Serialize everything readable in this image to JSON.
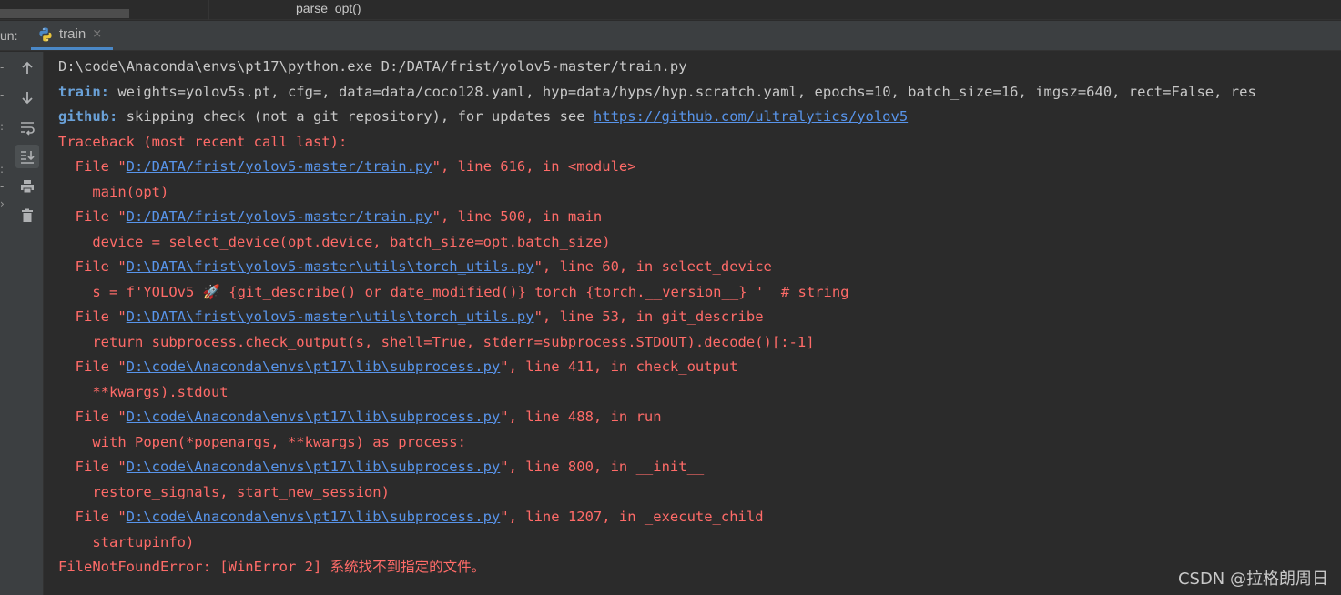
{
  "editor": {
    "code_line": "parse_opt()"
  },
  "run_panel": {
    "run_label": "un:",
    "tab_label": "train",
    "tab_close": "×"
  },
  "toolbar": {
    "buttons": [
      {
        "icon": "arrow-up-icon",
        "active": false
      },
      {
        "icon": "arrow-down-icon",
        "active": false
      },
      {
        "icon": "soft-wrap-icon",
        "active": false
      },
      {
        "icon": "scroll-to-end-icon",
        "active": true
      },
      {
        "icon": "print-icon",
        "active": false
      },
      {
        "icon": "trash-icon",
        "active": false
      }
    ]
  },
  "console": {
    "lines": [
      {
        "parts": [
          {
            "t": "D:\\code\\Anaconda\\envs\\pt17\\python.exe D:/DATA/frist/yolov5-master/train.py",
            "c": "normal"
          }
        ]
      },
      {
        "parts": [
          {
            "t": "train: ",
            "c": "key"
          },
          {
            "t": "weights=yolov5s.pt, cfg=, data=data/coco128.yaml, hyp=data/hyps/hyp.scratch.yaml, epochs=10, batch_size=16, imgsz=640, rect=False, res",
            "c": "normal"
          }
        ]
      },
      {
        "parts": [
          {
            "t": "github: ",
            "c": "key"
          },
          {
            "t": "skipping check (not a git repository), for updates see ",
            "c": "normal"
          },
          {
            "t": "https://github.com/ultralytics/yolov5",
            "c": "link"
          }
        ]
      },
      {
        "parts": [
          {
            "t": "Traceback (most recent call last):",
            "c": "err"
          }
        ]
      },
      {
        "parts": [
          {
            "t": "  File \"",
            "c": "err"
          },
          {
            "t": "D:/DATA/frist/yolov5-master/train.py",
            "c": "link"
          },
          {
            "t": "\", line 616, in <module>",
            "c": "err"
          }
        ]
      },
      {
        "parts": [
          {
            "t": "    main(opt)",
            "c": "err"
          }
        ]
      },
      {
        "parts": [
          {
            "t": "  File \"",
            "c": "err"
          },
          {
            "t": "D:/DATA/frist/yolov5-master/train.py",
            "c": "link"
          },
          {
            "t": "\", line 500, in main",
            "c": "err"
          }
        ]
      },
      {
        "parts": [
          {
            "t": "    device = select_device(opt.device, batch_size=opt.batch_size)",
            "c": "err"
          }
        ]
      },
      {
        "parts": [
          {
            "t": "  File \"",
            "c": "err"
          },
          {
            "t": "D:\\DATA\\frist\\yolov5-master\\utils\\torch_utils.py",
            "c": "link"
          },
          {
            "t": "\", line 60, in select_device",
            "c": "err"
          }
        ]
      },
      {
        "parts": [
          {
            "t": "    s = f'YOLOv5 🚀 {git_describe() or date_modified()} torch {torch.__version__} '  # string",
            "c": "err"
          }
        ]
      },
      {
        "parts": [
          {
            "t": "  File \"",
            "c": "err"
          },
          {
            "t": "D:\\DATA\\frist\\yolov5-master\\utils\\torch_utils.py",
            "c": "link"
          },
          {
            "t": "\", line 53, in git_describe",
            "c": "err"
          }
        ]
      },
      {
        "parts": [
          {
            "t": "    return subprocess.check_output(s, shell=True, stderr=subprocess.STDOUT).decode()[:-1]",
            "c": "err"
          }
        ]
      },
      {
        "parts": [
          {
            "t": "  File \"",
            "c": "err"
          },
          {
            "t": "D:\\code\\Anaconda\\envs\\pt17\\lib\\subprocess.py",
            "c": "link"
          },
          {
            "t": "\", line 411, in check_output",
            "c": "err"
          }
        ]
      },
      {
        "parts": [
          {
            "t": "    **kwargs).stdout",
            "c": "err"
          }
        ]
      },
      {
        "parts": [
          {
            "t": "  File \"",
            "c": "err"
          },
          {
            "t": "D:\\code\\Anaconda\\envs\\pt17\\lib\\subprocess.py",
            "c": "link"
          },
          {
            "t": "\", line 488, in run",
            "c": "err"
          }
        ]
      },
      {
        "parts": [
          {
            "t": "    with Popen(*popenargs, **kwargs) as process:",
            "c": "err"
          }
        ]
      },
      {
        "parts": [
          {
            "t": "  File \"",
            "c": "err"
          },
          {
            "t": "D:\\code\\Anaconda\\envs\\pt17\\lib\\subprocess.py",
            "c": "link"
          },
          {
            "t": "\", line 800, in __init__",
            "c": "err"
          }
        ]
      },
      {
        "parts": [
          {
            "t": "    restore_signals, start_new_session)",
            "c": "err"
          }
        ]
      },
      {
        "parts": [
          {
            "t": "  File \"",
            "c": "err"
          },
          {
            "t": "D:\\code\\Anaconda\\envs\\pt17\\lib\\subprocess.py",
            "c": "link"
          },
          {
            "t": "\", line 1207, in _execute_child",
            "c": "err"
          }
        ]
      },
      {
        "parts": [
          {
            "t": "    startupinfo)",
            "c": "err"
          }
        ]
      },
      {
        "parts": [
          {
            "t": "FileNotFoundError: [WinError 2] 系统找不到指定的文件。",
            "c": "err"
          }
        ]
      }
    ]
  },
  "watermark": "CSDN @拉格朗周日",
  "colors": {
    "background": "#2b2b2b",
    "panel": "#3c3f41",
    "error_text": "#ff6b68",
    "link": "#5894ea",
    "key": "#6aa1d8",
    "normal_text": "#c8c8c8"
  }
}
